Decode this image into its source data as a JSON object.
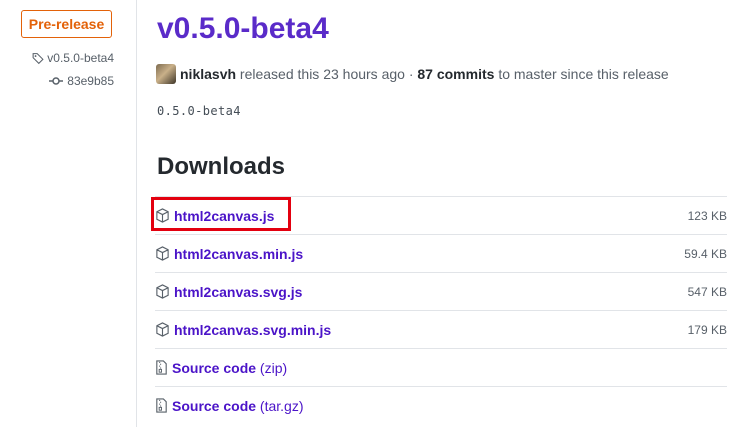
{
  "release": {
    "badge": "Pre-release",
    "tag": "v0.5.0-beta4",
    "commit": "83e9b85",
    "title": "v0.5.0-beta4",
    "author": "niklasvh",
    "released_text": "released this 23 hours ago",
    "separator": "·",
    "commits_count": "87 commits",
    "commits_suffix": "to master since this release",
    "description": "0.5.0-beta4"
  },
  "downloads": {
    "heading": "Downloads",
    "assets": [
      {
        "name": "html2canvas.js",
        "size": "123 KB",
        "icon": "package-icon"
      },
      {
        "name": "html2canvas.min.js",
        "size": "59.4 KB",
        "icon": "package-icon"
      },
      {
        "name": "html2canvas.svg.js",
        "size": "547 KB",
        "icon": "package-icon"
      },
      {
        "name": "html2canvas.svg.min.js",
        "size": "179 KB",
        "icon": "package-icon"
      },
      {
        "name": "Source code",
        "ext": "(zip)",
        "icon": "file-zip-icon"
      },
      {
        "name": "Source code",
        "ext": "(tar.gz)",
        "icon": "file-zip-icon"
      }
    ]
  },
  "annotation": {
    "highlight_color": "#e3000f",
    "highlighted_item": "html2canvas.js"
  },
  "colors": {
    "accent": "#4b14c8",
    "prerelease": "#e36209"
  }
}
